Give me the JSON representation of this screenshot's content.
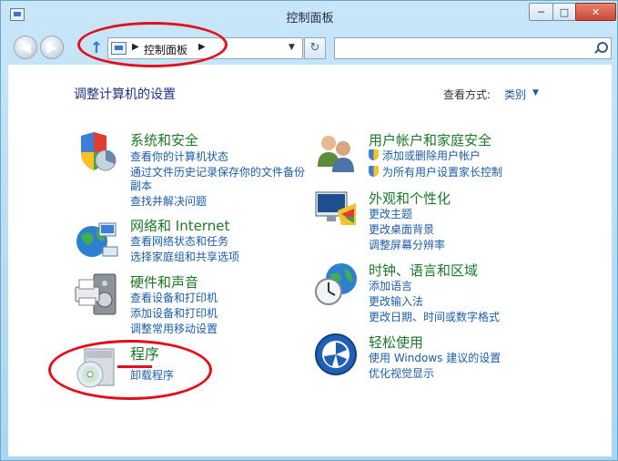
{
  "window": {
    "title": "控制面板"
  },
  "controls": {
    "minimize": "─",
    "maximize": "□",
    "close": "✕"
  },
  "nav": {
    "back": "◀",
    "forward": "▶",
    "up": "↑",
    "breadcrumb": "控制面板",
    "refresh": "↻",
    "search_placeholder": ""
  },
  "main": {
    "heading": "调整计算机的设置",
    "view_by_label": "查看方式:",
    "view_by_value": "类别"
  },
  "categories": {
    "system": {
      "title": "系统和安全",
      "links": [
        "查看你的计算机状态",
        "通过文件历史记录保存你的文件备份",
        "副本",
        "查找并解决问题"
      ]
    },
    "network": {
      "title": "网络和 Internet",
      "links": [
        "查看网络状态和任务",
        "选择家庭组和共享选项"
      ]
    },
    "hardware": {
      "title": "硬件和声音",
      "links": [
        "查看设备和打印机",
        "添加设备和打印机",
        "调整常用移动设置"
      ]
    },
    "programs": {
      "title": "程序",
      "links": [
        "卸载程序"
      ]
    },
    "user": {
      "title": "用户帐户和家庭安全",
      "links": [
        "添加或删除用户帐户",
        "为所有用户设置家长控制"
      ]
    },
    "appearance": {
      "title": "外观和个性化",
      "links": [
        "更改主题",
        "更改桌面背景",
        "调整屏幕分辨率"
      ]
    },
    "clock": {
      "title": "时钟、语言和区域",
      "links": [
        "添加语言",
        "更改输入法",
        "更改日期、时间或数字格式"
      ]
    },
    "ease": {
      "title": "轻松使用",
      "links": [
        "使用 Windows 建议的设置",
        "优化视觉显示"
      ]
    }
  },
  "colors": {
    "title_green": "#1a7a26",
    "link_blue": "#1b5dab",
    "annotation_red": "#e3101b"
  }
}
